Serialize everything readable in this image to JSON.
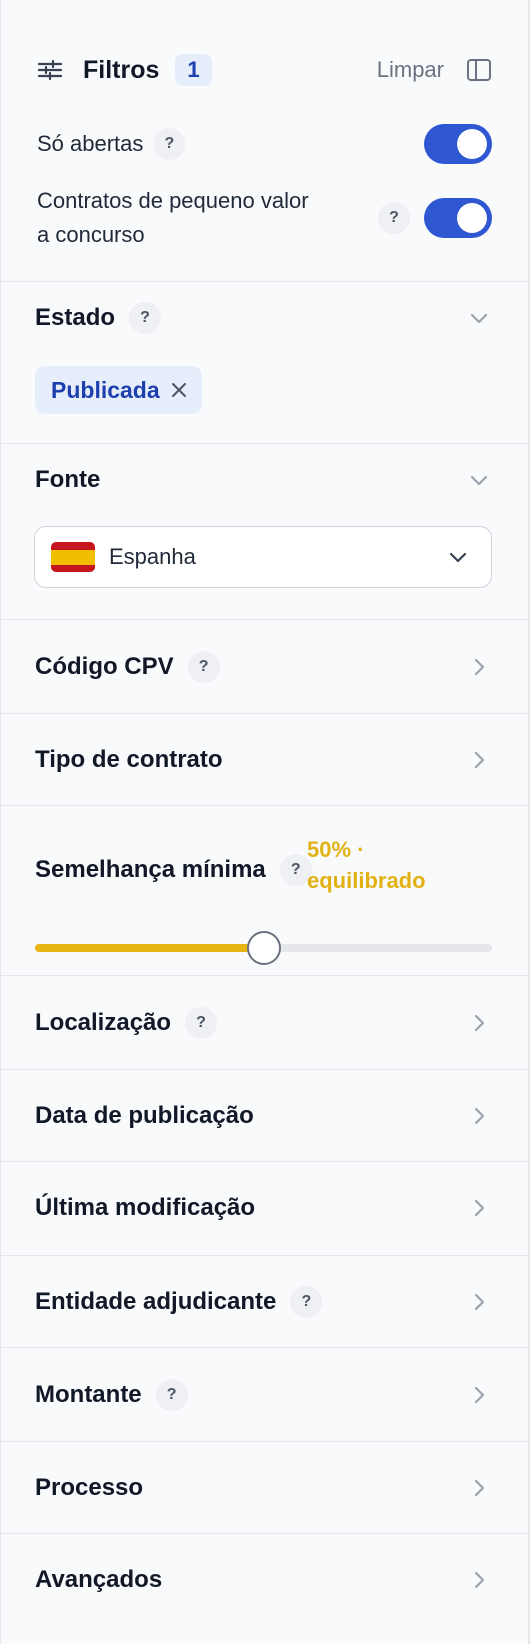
{
  "header": {
    "title": "Filtros",
    "badge_count": "1",
    "clear_label": "Limpar",
    "icons": [
      "sliders-icon",
      "sidebar-panel-icon"
    ]
  },
  "toggles": [
    {
      "label": "Só abertas",
      "help": "?",
      "enabled": true
    },
    {
      "label_line1": "Contratos de pequeno valor",
      "label_line2": "a concurso",
      "help": "?",
      "enabled": true
    }
  ],
  "sections": {
    "estado": {
      "title": "Estado",
      "help": "?",
      "chip": "Publicada"
    },
    "fonte": {
      "title": "Fonte",
      "selected": "Espanha"
    },
    "cpv": {
      "title": "Código CPV",
      "help": "?"
    },
    "tipo": {
      "title": "Tipo de contrato"
    },
    "semelhanca": {
      "title": "Semelhança mínima",
      "help": "?",
      "value_line1": "50% ·",
      "value_line2": "equilibrado",
      "value_percent": 50
    },
    "localizacao": {
      "title": "Localização",
      "help": "?"
    },
    "data_publicacao": {
      "title": "Data de publicação"
    },
    "ultima_modificacao": {
      "title": "Última modificação"
    },
    "entidade": {
      "title": "Entidade adjudicante",
      "help": "?"
    },
    "montante": {
      "title": "Montante",
      "help": "?"
    },
    "processo": {
      "title": "Processo"
    },
    "avancados": {
      "title": "Avançados"
    }
  },
  "colors": {
    "accent_blue": "#2f57d1",
    "chip_bg": "#e6edfb",
    "chip_text": "#1e40af",
    "slider_fill": "#e8b414",
    "similarity_text": "#e2b214"
  }
}
